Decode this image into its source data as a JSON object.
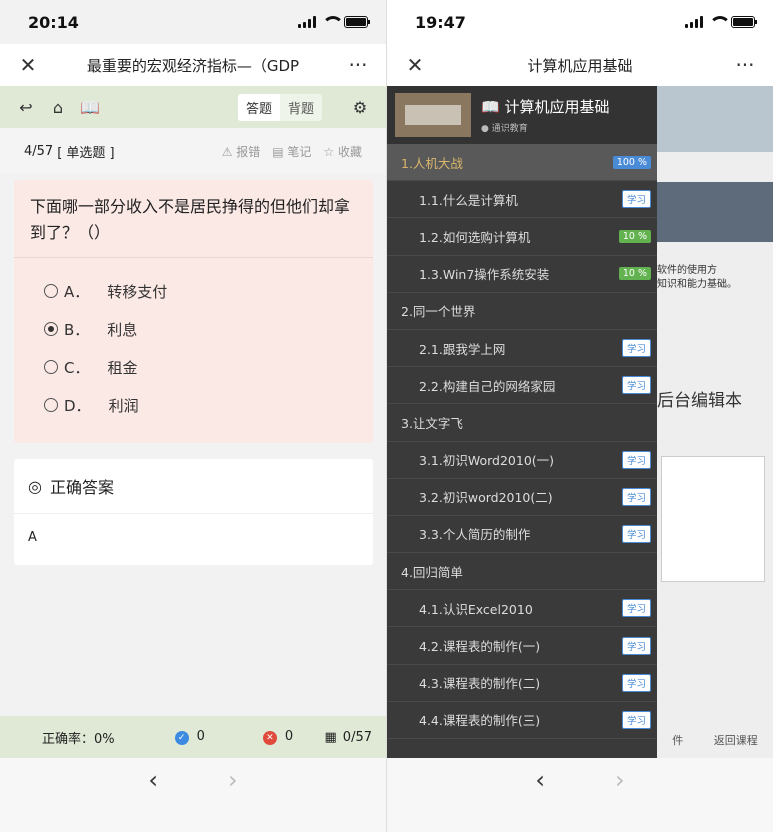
{
  "left": {
    "time": "20:14",
    "title": "最重要的宏观经济指标—（GDP",
    "tabs": [
      "答题",
      "背题"
    ],
    "progress": "4/57",
    "qtype": "[ 单选题 ]",
    "meta": [
      "⚠ 报错",
      "▤ 笔记",
      "☆ 收藏"
    ],
    "question": "下面哪一部分收入不是居民挣得的但他们却拿到了？（）",
    "options": [
      {
        "k": "A．",
        "t": "转移支付"
      },
      {
        "k": "B．",
        "t": "利息"
      },
      {
        "k": "C．",
        "t": "租金"
      },
      {
        "k": "D．",
        "t": "利润"
      }
    ],
    "selected": 1,
    "answer_title": "正确答案",
    "answer": "A",
    "accuracy": "正确率：0%",
    "correct": "0",
    "wrong": "0",
    "count": "0/57"
  },
  "right": {
    "time": "19:47",
    "title": "计算机应用基础",
    "course": "计算机应用基础",
    "school": "通识教育",
    "bg_text1": "软件的使用方",
    "bg_text2": "知识和能力基础。",
    "bg_text3": "后台编辑本",
    "bg_foot1": "件",
    "bg_foot2": "返回课程",
    "rows": [
      {
        "type": "ch",
        "label": "1.人机大战",
        "tag": "100 %",
        "tagtype": "full",
        "hl": true
      },
      {
        "type": "sub",
        "label": "1.1.什么是计算机",
        "tag": "学习",
        "tagtype": "learn"
      },
      {
        "type": "sub",
        "label": "1.2.如何选购计算机",
        "tag": "10 %",
        "tagtype": "pct"
      },
      {
        "type": "sub",
        "label": "1.3.Win7操作系统安装",
        "tag": "10 %",
        "tagtype": "pct"
      },
      {
        "type": "ch",
        "label": "2.同一个世界",
        "tag": "",
        "tagtype": ""
      },
      {
        "type": "sub",
        "label": "2.1.跟我学上网",
        "tag": "学习",
        "tagtype": "learn"
      },
      {
        "type": "sub",
        "label": "2.2.构建自己的网络家园",
        "tag": "学习",
        "tagtype": "learn"
      },
      {
        "type": "ch",
        "label": "3.让文字飞",
        "tag": "",
        "tagtype": ""
      },
      {
        "type": "sub",
        "label": "3.1.初识Word2010(一)",
        "tag": "学习",
        "tagtype": "learn"
      },
      {
        "type": "sub",
        "label": "3.2.初识word2010(二)",
        "tag": "学习",
        "tagtype": "learn"
      },
      {
        "type": "sub",
        "label": "3.3.个人简历的制作",
        "tag": "学习",
        "tagtype": "learn"
      },
      {
        "type": "ch",
        "label": "4.回归简单",
        "tag": "",
        "tagtype": ""
      },
      {
        "type": "sub",
        "label": "4.1.认识Excel2010",
        "tag": "学习",
        "tagtype": "learn"
      },
      {
        "type": "sub",
        "label": "4.2.课程表的制作(一)",
        "tag": "学习",
        "tagtype": "learn"
      },
      {
        "type": "sub",
        "label": "4.3.课程表的制作(二)",
        "tag": "学习",
        "tagtype": "learn"
      },
      {
        "type": "sub",
        "label": "4.4.课程表的制作(三)",
        "tag": "学习",
        "tagtype": "learn"
      }
    ]
  },
  "browser": {
    "back": "‹",
    "forward": "›"
  }
}
